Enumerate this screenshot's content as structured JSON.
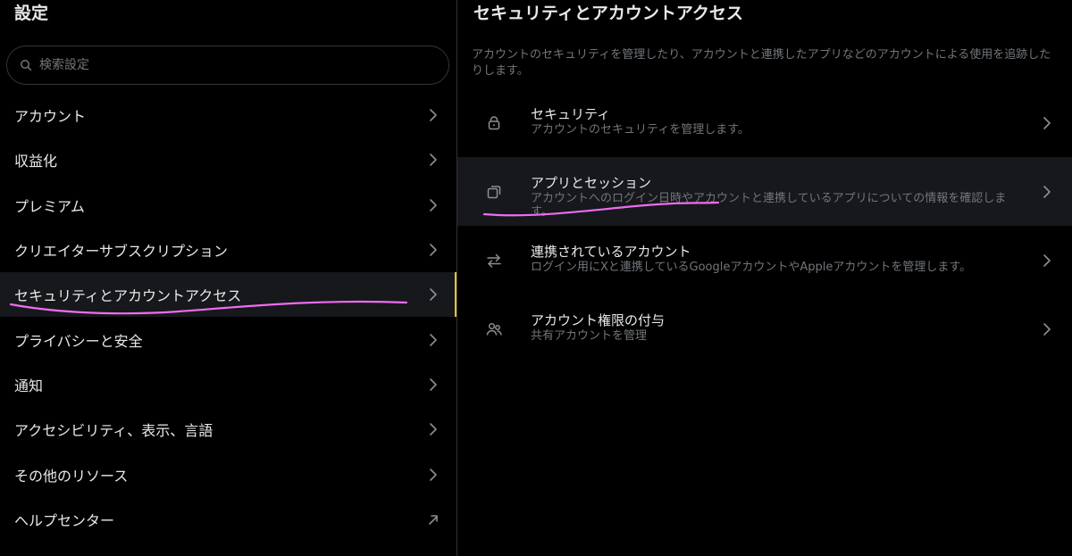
{
  "left_panel": {
    "title": "設定",
    "search": {
      "placeholder": "検索設定",
      "value": ""
    },
    "nav_items": [
      {
        "label": "アカウント",
        "icon": "chevron-right-icon"
      },
      {
        "label": "収益化",
        "icon": "chevron-right-icon"
      },
      {
        "label": "プレミアム",
        "icon": "chevron-right-icon"
      },
      {
        "label": "クリエイターサブスクリプション",
        "icon": "chevron-right-icon"
      },
      {
        "label": "セキュリティとアカウントアクセス",
        "icon": "chevron-right-icon",
        "active": true
      },
      {
        "label": "プライバシーと安全",
        "icon": "chevron-right-icon"
      },
      {
        "label": "通知",
        "icon": "chevron-right-icon"
      },
      {
        "label": "アクセシビリティ、表示、言語",
        "icon": "chevron-right-icon"
      },
      {
        "label": "その他のリソース",
        "icon": "chevron-right-icon"
      },
      {
        "label": "ヘルプセンター",
        "icon": "external-link-icon"
      }
    ]
  },
  "right_panel": {
    "title": "セキュリティとアカウントアクセス",
    "description": "アカウントのセキュリティを管理したり、アカウントと連携したアプリなどのアカウントによる使用を追跡したりします。",
    "items": [
      {
        "title": "セキュリティ",
        "description": "アカウントのセキュリティを管理します。",
        "icon": "lock-icon"
      },
      {
        "title": "アプリとセッション",
        "description": "アカウントへのログイン日時やアカウントと連携しているアプリについての情報を確認します。",
        "icon": "copy-icon",
        "hover": true
      },
      {
        "title": "連携されているアカウント",
        "description": "ログイン用にXと連携しているGoogleアカウントやAppleアカウントを管理します。",
        "icon": "swap-arrows-icon"
      },
      {
        "title": "アカウント権限の付与",
        "description": "共有アカウントを管理",
        "icon": "people-icon"
      }
    ]
  },
  "colors": {
    "background": "#000000",
    "text_primary": "#e7e9ea",
    "text_secondary": "#71767b",
    "active_bg": "#16181c",
    "active_indicator": "#f4c430",
    "annotation": "#f06cf0"
  }
}
